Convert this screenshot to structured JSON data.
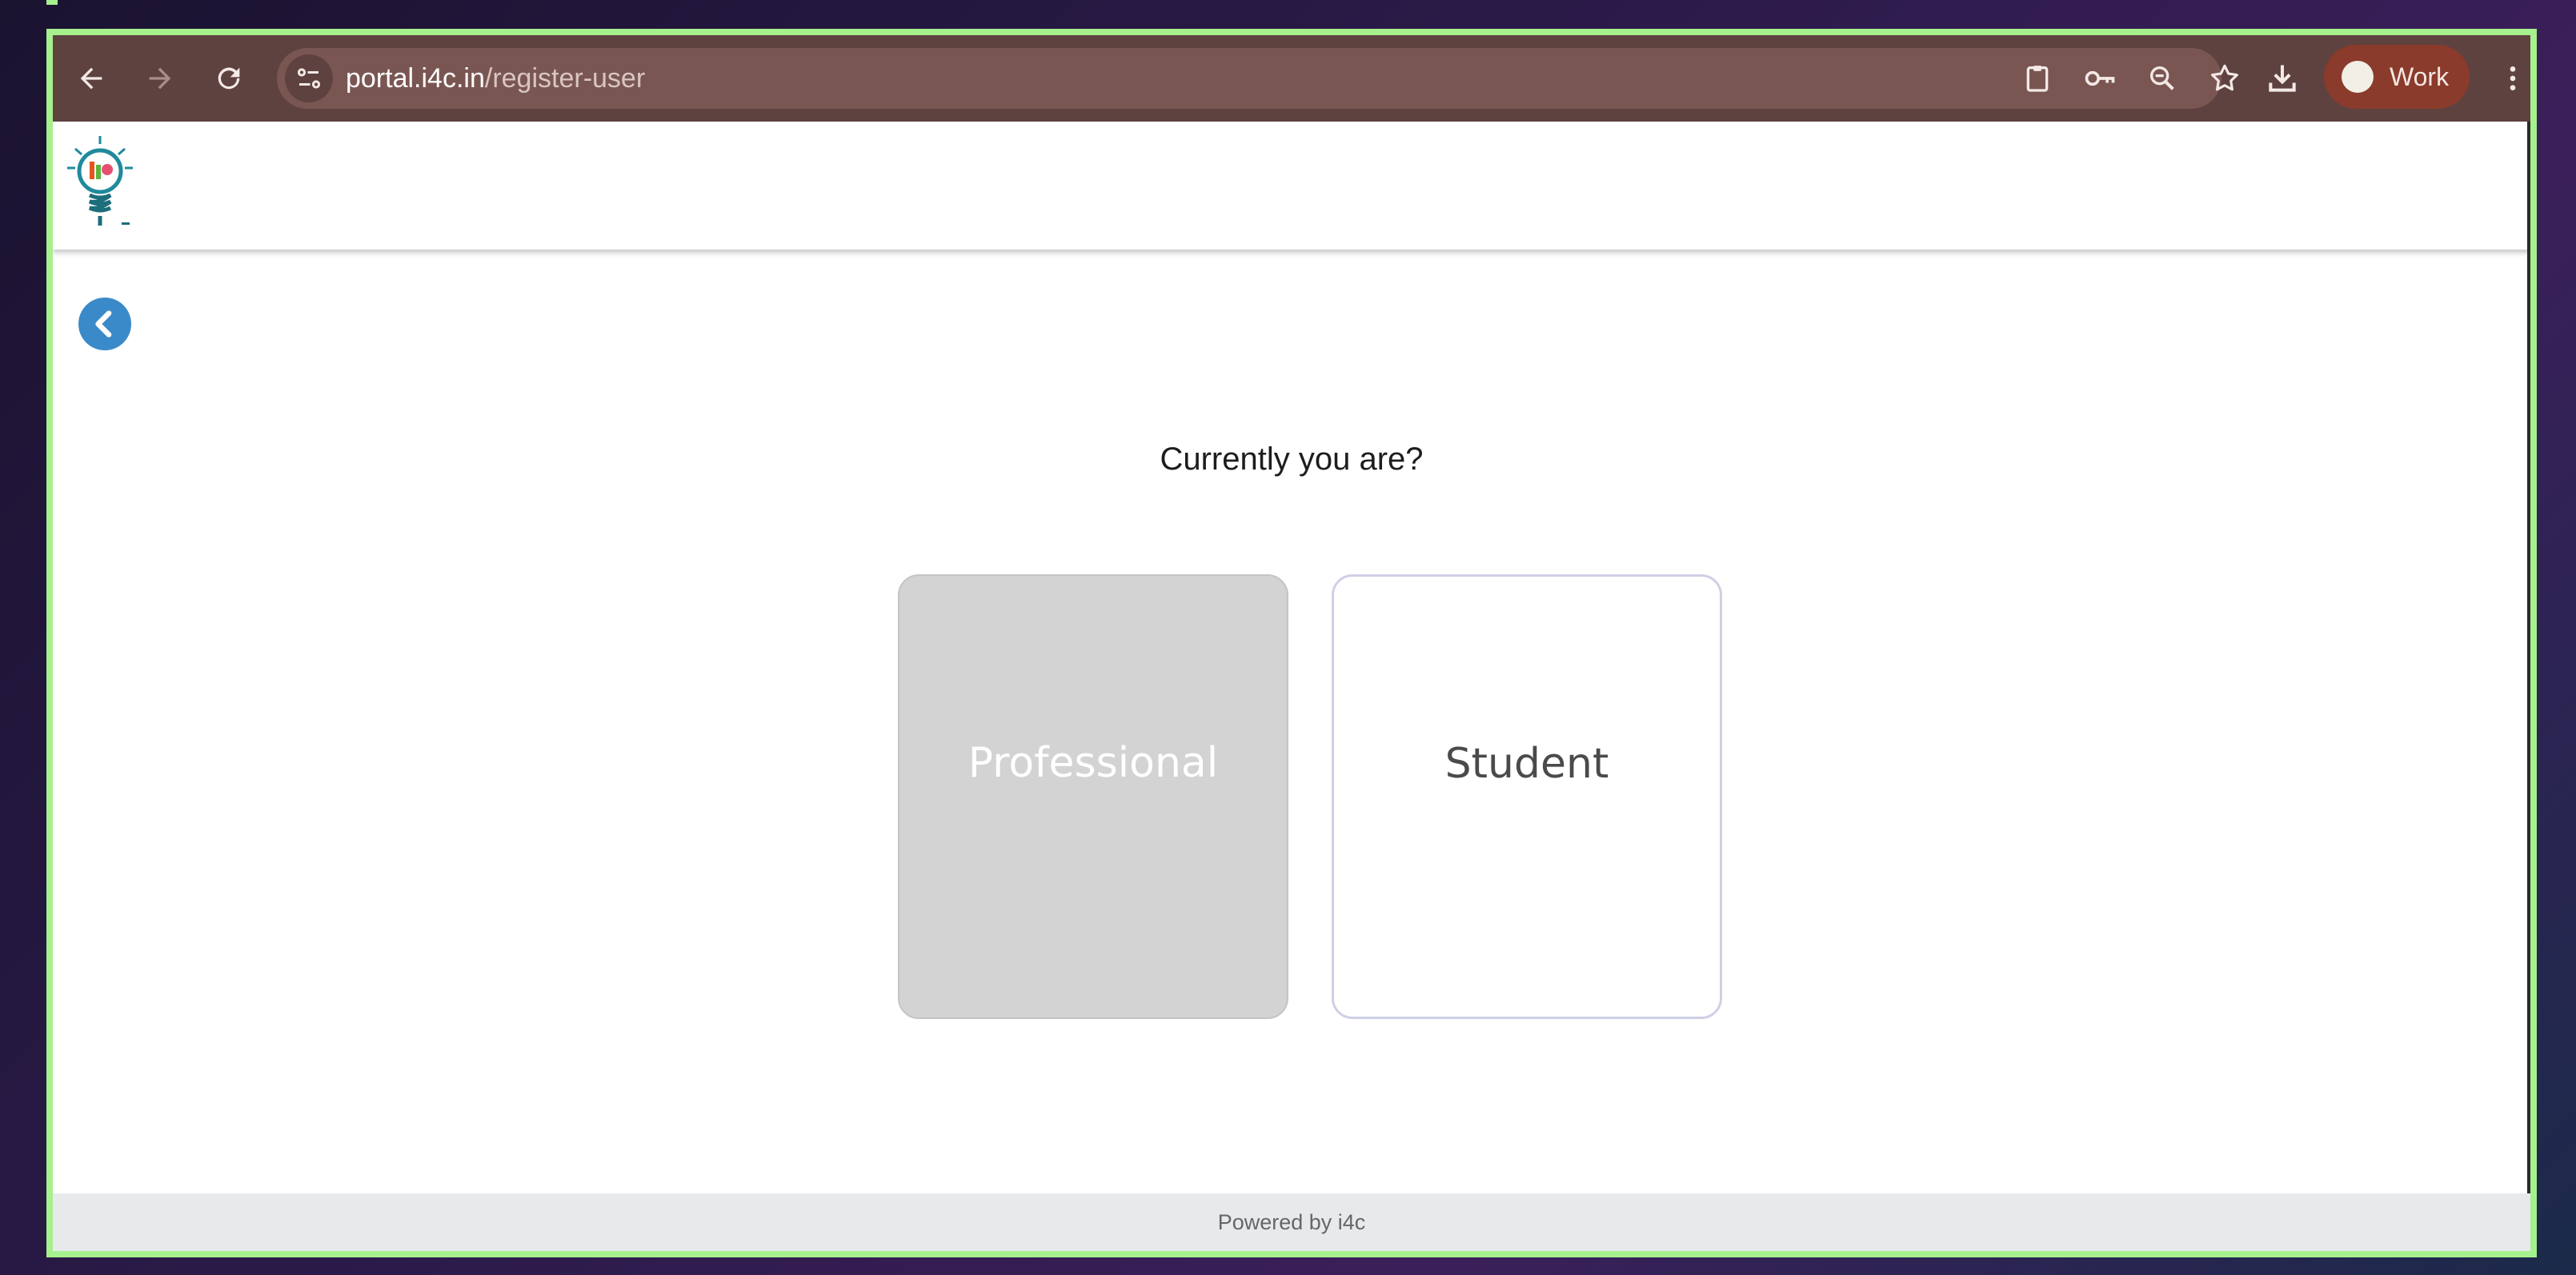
{
  "browser": {
    "url_host": "portal.i4c.in",
    "url_path": "/register-user",
    "profile_label": "Work",
    "icons": [
      "back-icon",
      "forward-icon",
      "reload-icon",
      "site-settings-icon",
      "clipboard-icon",
      "password-key-icon",
      "zoom-icon",
      "bookmark-star-icon",
      "download-icon",
      "menu-kebab-icon"
    ]
  },
  "page": {
    "question": "Currently you are?",
    "options": [
      "Professional",
      "Student"
    ],
    "footer": "Powered by i4c"
  },
  "colors": {
    "accent_border": "#a6f08e",
    "toolbar": "#5e4240",
    "back_button": "#3a8ac9",
    "professional_card": "#d3d3d3",
    "footer_bg": "#e7e9eb"
  }
}
